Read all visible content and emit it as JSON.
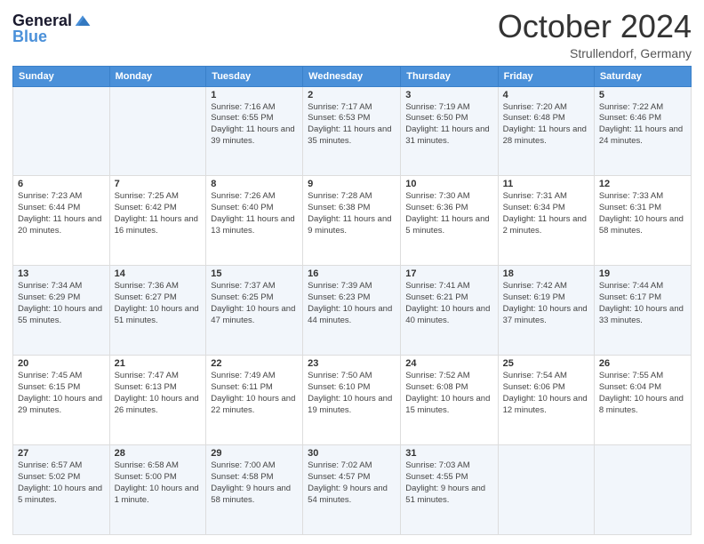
{
  "header": {
    "logo_line1": "General",
    "logo_line2": "Blue",
    "month": "October 2024",
    "location": "Strullendorf, Germany"
  },
  "columns": [
    "Sunday",
    "Monday",
    "Tuesday",
    "Wednesday",
    "Thursday",
    "Friday",
    "Saturday"
  ],
  "weeks": [
    [
      {
        "day": "",
        "info": ""
      },
      {
        "day": "",
        "info": ""
      },
      {
        "day": "1",
        "info": "Sunrise: 7:16 AM\nSunset: 6:55 PM\nDaylight: 11 hours and 39 minutes."
      },
      {
        "day": "2",
        "info": "Sunrise: 7:17 AM\nSunset: 6:53 PM\nDaylight: 11 hours and 35 minutes."
      },
      {
        "day": "3",
        "info": "Sunrise: 7:19 AM\nSunset: 6:50 PM\nDaylight: 11 hours and 31 minutes."
      },
      {
        "day": "4",
        "info": "Sunrise: 7:20 AM\nSunset: 6:48 PM\nDaylight: 11 hours and 28 minutes."
      },
      {
        "day": "5",
        "info": "Sunrise: 7:22 AM\nSunset: 6:46 PM\nDaylight: 11 hours and 24 minutes."
      }
    ],
    [
      {
        "day": "6",
        "info": "Sunrise: 7:23 AM\nSunset: 6:44 PM\nDaylight: 11 hours and 20 minutes."
      },
      {
        "day": "7",
        "info": "Sunrise: 7:25 AM\nSunset: 6:42 PM\nDaylight: 11 hours and 16 minutes."
      },
      {
        "day": "8",
        "info": "Sunrise: 7:26 AM\nSunset: 6:40 PM\nDaylight: 11 hours and 13 minutes."
      },
      {
        "day": "9",
        "info": "Sunrise: 7:28 AM\nSunset: 6:38 PM\nDaylight: 11 hours and 9 minutes."
      },
      {
        "day": "10",
        "info": "Sunrise: 7:30 AM\nSunset: 6:36 PM\nDaylight: 11 hours and 5 minutes."
      },
      {
        "day": "11",
        "info": "Sunrise: 7:31 AM\nSunset: 6:34 PM\nDaylight: 11 hours and 2 minutes."
      },
      {
        "day": "12",
        "info": "Sunrise: 7:33 AM\nSunset: 6:31 PM\nDaylight: 10 hours and 58 minutes."
      }
    ],
    [
      {
        "day": "13",
        "info": "Sunrise: 7:34 AM\nSunset: 6:29 PM\nDaylight: 10 hours and 55 minutes."
      },
      {
        "day": "14",
        "info": "Sunrise: 7:36 AM\nSunset: 6:27 PM\nDaylight: 10 hours and 51 minutes."
      },
      {
        "day": "15",
        "info": "Sunrise: 7:37 AM\nSunset: 6:25 PM\nDaylight: 10 hours and 47 minutes."
      },
      {
        "day": "16",
        "info": "Sunrise: 7:39 AM\nSunset: 6:23 PM\nDaylight: 10 hours and 44 minutes."
      },
      {
        "day": "17",
        "info": "Sunrise: 7:41 AM\nSunset: 6:21 PM\nDaylight: 10 hours and 40 minutes."
      },
      {
        "day": "18",
        "info": "Sunrise: 7:42 AM\nSunset: 6:19 PM\nDaylight: 10 hours and 37 minutes."
      },
      {
        "day": "19",
        "info": "Sunrise: 7:44 AM\nSunset: 6:17 PM\nDaylight: 10 hours and 33 minutes."
      }
    ],
    [
      {
        "day": "20",
        "info": "Sunrise: 7:45 AM\nSunset: 6:15 PM\nDaylight: 10 hours and 29 minutes."
      },
      {
        "day": "21",
        "info": "Sunrise: 7:47 AM\nSunset: 6:13 PM\nDaylight: 10 hours and 26 minutes."
      },
      {
        "day": "22",
        "info": "Sunrise: 7:49 AM\nSunset: 6:11 PM\nDaylight: 10 hours and 22 minutes."
      },
      {
        "day": "23",
        "info": "Sunrise: 7:50 AM\nSunset: 6:10 PM\nDaylight: 10 hours and 19 minutes."
      },
      {
        "day": "24",
        "info": "Sunrise: 7:52 AM\nSunset: 6:08 PM\nDaylight: 10 hours and 15 minutes."
      },
      {
        "day": "25",
        "info": "Sunrise: 7:54 AM\nSunset: 6:06 PM\nDaylight: 10 hours and 12 minutes."
      },
      {
        "day": "26",
        "info": "Sunrise: 7:55 AM\nSunset: 6:04 PM\nDaylight: 10 hours and 8 minutes."
      }
    ],
    [
      {
        "day": "27",
        "info": "Sunrise: 6:57 AM\nSunset: 5:02 PM\nDaylight: 10 hours and 5 minutes."
      },
      {
        "day": "28",
        "info": "Sunrise: 6:58 AM\nSunset: 5:00 PM\nDaylight: 10 hours and 1 minute."
      },
      {
        "day": "29",
        "info": "Sunrise: 7:00 AM\nSunset: 4:58 PM\nDaylight: 9 hours and 58 minutes."
      },
      {
        "day": "30",
        "info": "Sunrise: 7:02 AM\nSunset: 4:57 PM\nDaylight: 9 hours and 54 minutes."
      },
      {
        "day": "31",
        "info": "Sunrise: 7:03 AM\nSunset: 4:55 PM\nDaylight: 9 hours and 51 minutes."
      },
      {
        "day": "",
        "info": ""
      },
      {
        "day": "",
        "info": ""
      }
    ]
  ]
}
